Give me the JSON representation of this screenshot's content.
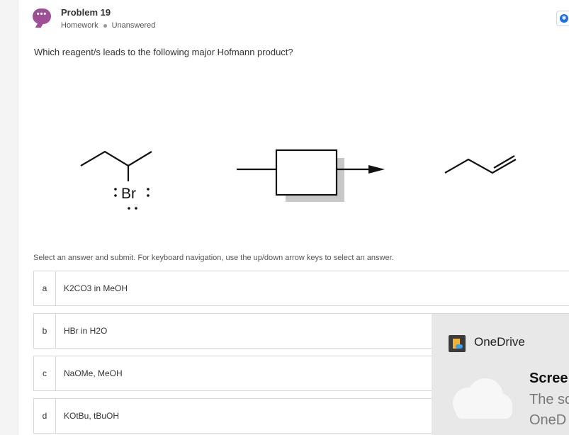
{
  "problem": {
    "title": "Problem 19",
    "category": "Homework",
    "status": "Unanswered",
    "avatar_glyph": "•••"
  },
  "corner_button": {
    "glyph": "✱"
  },
  "question": {
    "text": "Which reagent/s leads to the following major Hofmann product?"
  },
  "reaction": {
    "reactant_label": "Br"
  },
  "instruction": "Select an answer and submit. For keyboard navigation, use the up/down arrow keys to select an answer.",
  "options": [
    {
      "letter": "a",
      "text": "K2CO3 in MeOH"
    },
    {
      "letter": "b",
      "text": "HBr in H2O"
    },
    {
      "letter": "c",
      "text": "NaOMe, MeOH"
    },
    {
      "letter": "d",
      "text": "KOtBu, tBuOH"
    }
  ],
  "notification": {
    "app_name": "OneDrive",
    "heading": "Scree",
    "line1": "The sc",
    "line2": "OneD",
    "icon": "onedrive-icon"
  },
  "colors": {
    "accent_purple": "#9e4f96",
    "link_blue": "#1f6fe5"
  }
}
